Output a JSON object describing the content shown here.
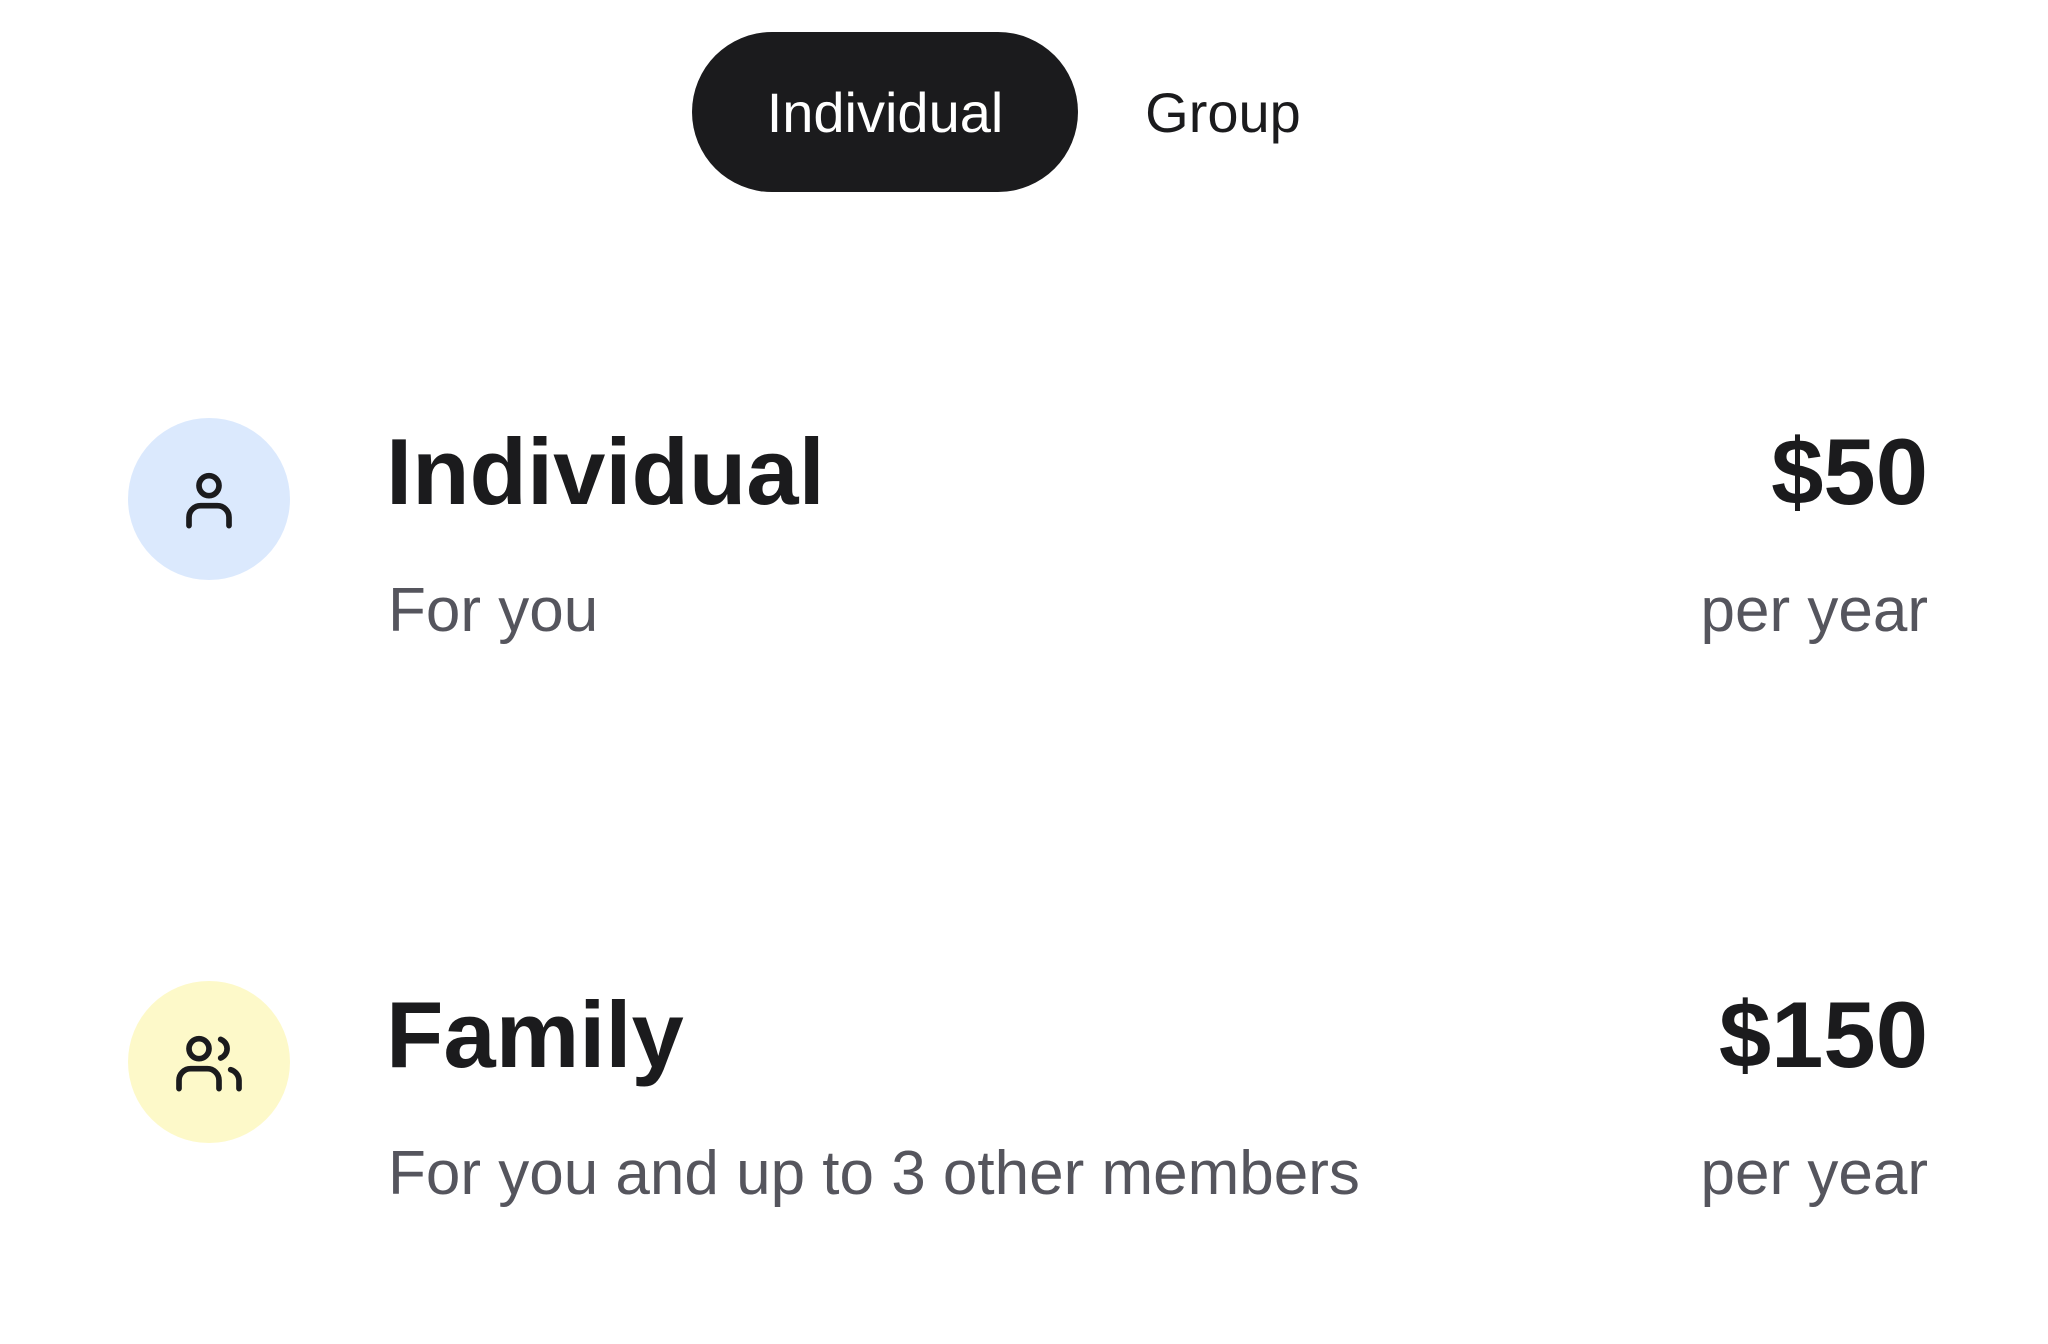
{
  "toggle": {
    "options": [
      {
        "label": "Individual",
        "selected": true
      },
      {
        "label": "Group",
        "selected": false
      }
    ],
    "active_bg": "#1b1b1d"
  },
  "plans": [
    {
      "icon": "person-icon",
      "icon_bg": "#dbe9fd",
      "title": "Individual",
      "description": "For you",
      "price": "$50",
      "period": "per year"
    },
    {
      "icon": "people-icon",
      "icon_bg": "#fdf9c9",
      "title": "Family",
      "description": "For you and up to 3 other members",
      "price": "$150",
      "period": "per year"
    }
  ],
  "colors": {
    "text": "#1b1b1d",
    "muted": "#55555d"
  }
}
